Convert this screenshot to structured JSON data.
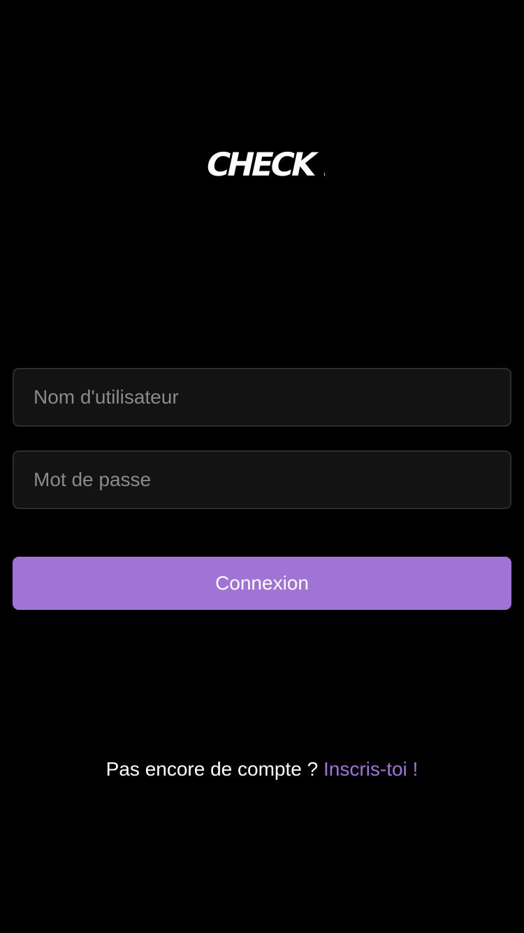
{
  "app": {
    "logo_text": "CHECK !T"
  },
  "form": {
    "username_placeholder": "Nom d'utilisateur",
    "username_value": "",
    "password_placeholder": "Mot de passe",
    "password_value": "",
    "login_label": "Connexion"
  },
  "signup": {
    "prompt": "Pas encore de compte ?",
    "link_label": "Inscris-toi !"
  },
  "colors": {
    "background": "#000000",
    "accent": "#a273d7",
    "field_background": "#131313",
    "field_border": "#2d2d2d",
    "placeholder": "#8a8a8a",
    "text": "#ffffff"
  }
}
